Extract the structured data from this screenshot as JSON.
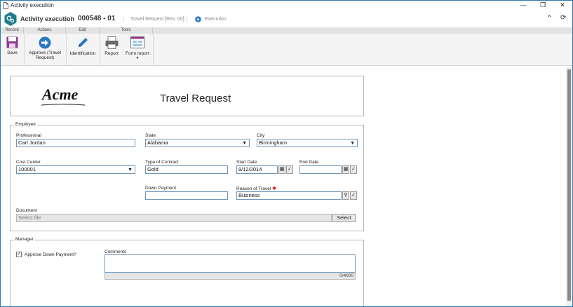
{
  "window": {
    "title": "Activity execution"
  },
  "header": {
    "app": "Activity execution",
    "record_id": "000548 - 01",
    "doc": "Travel Request [Rev. 00]",
    "status": "Execution"
  },
  "ribbon": {
    "groups": [
      "Record",
      "Actions",
      "Edit",
      "Tools"
    ],
    "save": "Save",
    "approve": "Approve (Travel Request)",
    "identification": "Identification",
    "report": "Report",
    "form_report": "Form report"
  },
  "form": {
    "logo": "Acme",
    "title": "Travel Request",
    "employee_legend": "Employee",
    "professional_label": "Professional",
    "professional_value": "Carl Jordan",
    "state_label": "State",
    "state_value": "Alabama",
    "city_label": "City",
    "city_value": "Birmingham",
    "cost_center_label": "Cost Center",
    "cost_center_value": "100001",
    "contract_label": "Type of Contract",
    "contract_value": "Gold",
    "start_label": "Start Date",
    "start_value": "9/12/2014",
    "end_label": "End Date",
    "end_value": "",
    "down_payment_label": "Down Payment",
    "down_payment_value": "",
    "reason_label": "Reason of Travel",
    "reason_value": "Business",
    "document_label": "Document",
    "document_placeholder": "Select file",
    "select_button": "Select",
    "manager_legend": "Manager",
    "approve_down_label": "Approve Down Payment?",
    "comments_label": "Comments",
    "comments_counter": "0/4000"
  }
}
